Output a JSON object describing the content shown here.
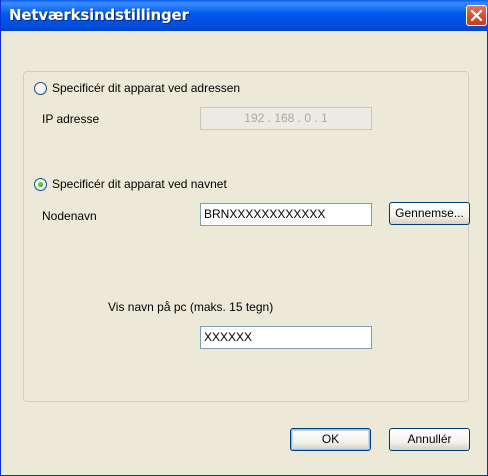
{
  "window": {
    "title": "Netværksindstillinger"
  },
  "address_option": {
    "label": "Specificér dit apparat ved adressen",
    "selected": false,
    "ip_label": "IP adresse",
    "ip_value": "192 . 168 .  0  .  1"
  },
  "name_option": {
    "label": "Specificér dit apparat ved navnet",
    "selected": true,
    "node_label": "Nodenavn",
    "node_value": "BRNXXXXXXXXXXXX",
    "browse_label": "Gennemse..."
  },
  "pc_name": {
    "label": "Vis navn på pc (maks. 15 tegn)",
    "value": "XXXXXX"
  },
  "footer": {
    "ok_label": "OK",
    "cancel_label": "Annullér"
  },
  "colors": {
    "titlebar": "#0058EE",
    "dialog_bg": "#ECE9D8",
    "close_button": "#D4502E"
  }
}
